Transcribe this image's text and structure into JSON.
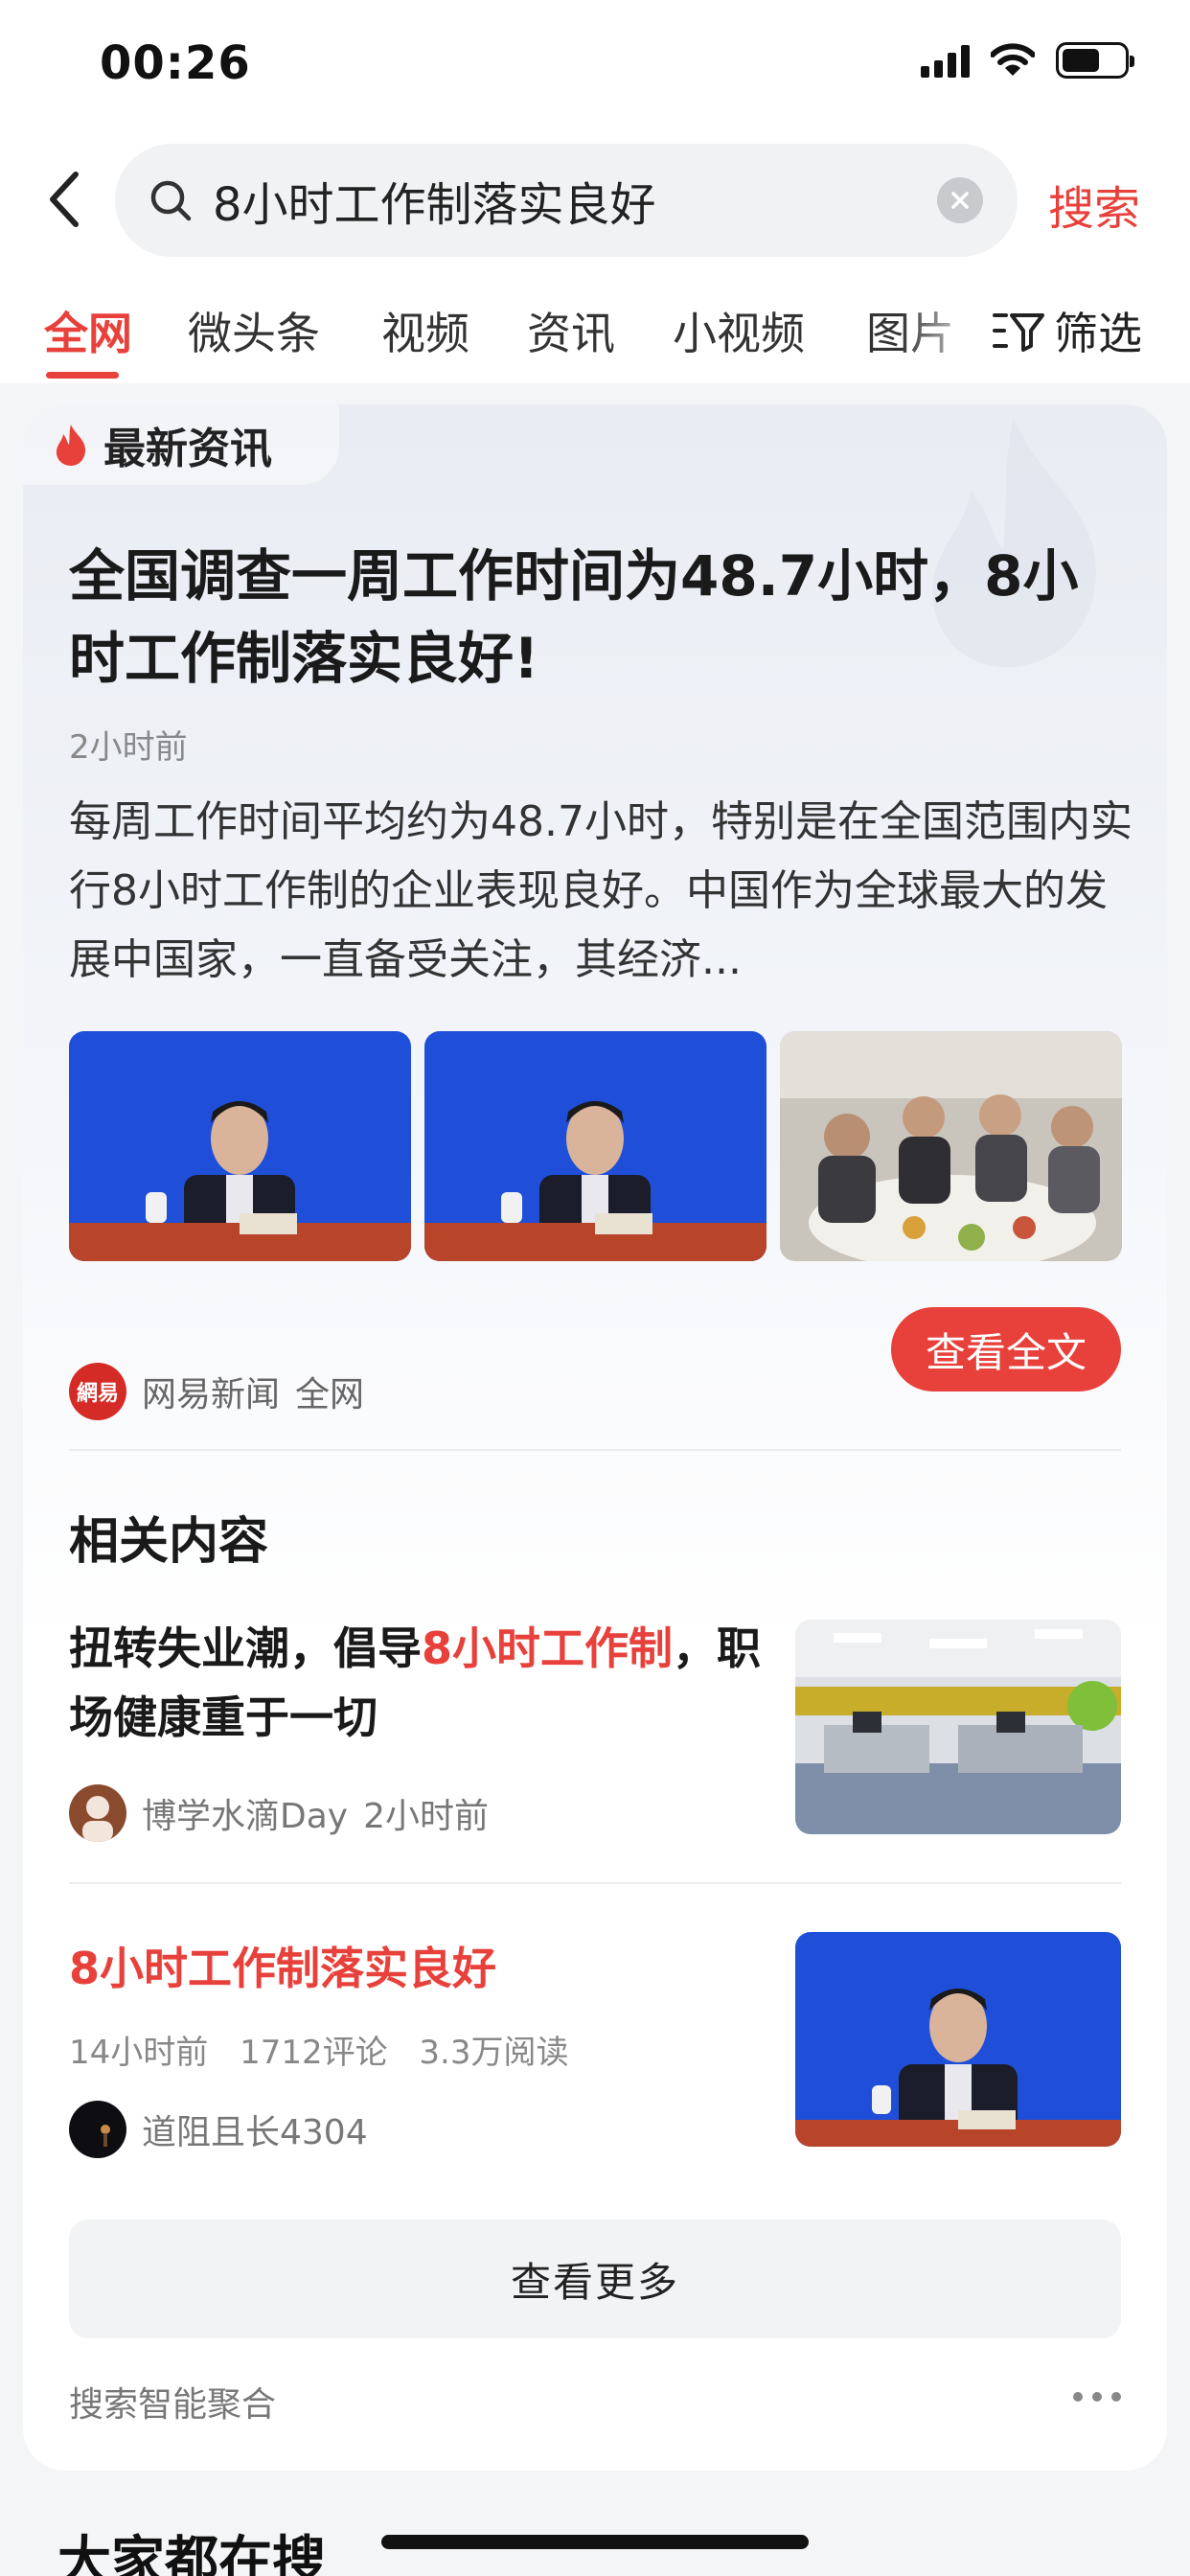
{
  "status_bar": {
    "time": "00:26"
  },
  "search": {
    "query": "8小时工作制落实良好",
    "submit_label": "搜索"
  },
  "tabs": [
    {
      "label": "全网"
    },
    {
      "label": "微头条"
    },
    {
      "label": "视频"
    },
    {
      "label": "资讯"
    },
    {
      "label": "小视频"
    },
    {
      "label": "图片"
    }
  ],
  "filter_label": "筛选",
  "card": {
    "label": "最新资讯",
    "headline": "全国调查一周工作时间为48.7小时，8小时工作制落实良好!",
    "time_ago": "2小时前",
    "summary": "每周工作时间平均约为48.7小时，特别是在全国范围内实行8小时工作制的企业表现良好。中国作为全球最大的发展中国家，一直备受关注，其经济...",
    "source_logo_text": "網易",
    "source_name": "网易新闻",
    "source_scope": "全网",
    "view_full_label": "查看全文"
  },
  "related": {
    "title": "相关内容",
    "items": [
      {
        "title_before": "扭转失业潮，倡导",
        "title_highlight": "8小时工作制",
        "title_after": "，职场健康重于一切",
        "author": "博学水滴Day",
        "time": "2小时前"
      },
      {
        "title": "8小时工作制落实良好",
        "time": "14小时前",
        "comments": "1712评论",
        "reads": "3.3万阅读",
        "author": "道阻且长4304"
      }
    ],
    "more_label": "查看更多",
    "aggregation_label": "搜索智能聚合"
  },
  "bottom_heading": "大家都在搜",
  "colors": {
    "accent": "#e8413b",
    "press_blue": "#1f4fd8"
  }
}
